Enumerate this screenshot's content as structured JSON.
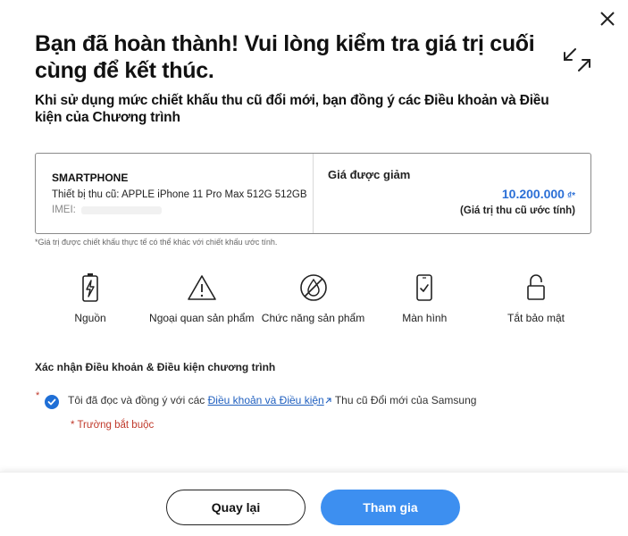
{
  "header": {
    "title": "Bạn đã hoàn thành! Vui lòng kiểm tra giá trị cuối cùng để kết thúc.",
    "subtitle": "Khi sử dụng mức chiết khấu thu cũ đổi mới, bạn đồng ý các Điều khoản và Điều kiện của Chương trình",
    "close_icon": "close-icon",
    "expand_icon": "expand-arrows-icon"
  },
  "device": {
    "type": "SMARTPHONE",
    "name": "Thiết bị thu cũ: APPLE iPhone 11 Pro Max 512G 512GB",
    "imei_label": "IMEI:",
    "discount_label": "Giá được giảm",
    "price": "10.200.000",
    "currency": "₫*",
    "price_note": "(Giá trị thu cũ ước tính)"
  },
  "disclaimer": "*Giá trị được chiết khấu thực tế có thể khác với chiết khấu ước tính.",
  "conditions": [
    {
      "label": "Nguồn",
      "icon": "battery-icon"
    },
    {
      "label": "Ngoại quan sản phẩm",
      "icon": "warning-triangle-icon"
    },
    {
      "label": "Chức năng sản phẩm",
      "icon": "water-damage-icon"
    },
    {
      "label": "Màn hình",
      "icon": "phone-screen-icon"
    },
    {
      "label": "Tắt bảo mật",
      "icon": "unlock-icon"
    }
  ],
  "terms": {
    "heading": "Xác nhận Điều khoản & Điều kiện chương trình",
    "required_star": "*",
    "text_before": "Tôi đã đọc và đồng ý với các ",
    "link_text": "Điều khoản và Điều kiện",
    "text_after": " Thu cũ Đổi mới của Samsung",
    "checked": true,
    "required_note": "* Trường bắt buộc"
  },
  "footer": {
    "back_label": "Quay lại",
    "join_label": "Tham gia"
  },
  "colors": {
    "accent": "#3d8ff0",
    "link": "#1f5fbf",
    "required": "#c0392b",
    "price": "#2b6fd6"
  }
}
